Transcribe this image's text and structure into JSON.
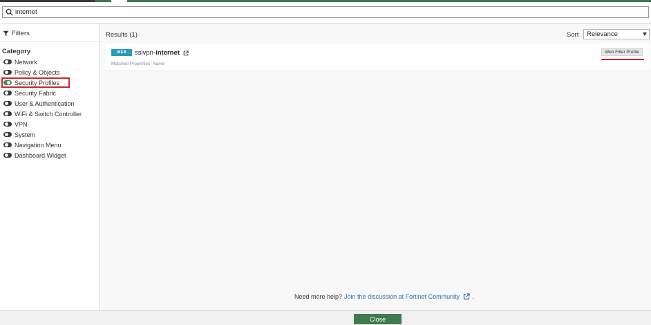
{
  "search": {
    "value": "internet"
  },
  "sidebar": {
    "filters_label": "Filters",
    "category_label": "Category",
    "items": [
      {
        "label": "Network",
        "enabled": false
      },
      {
        "label": "Policy & Objects",
        "enabled": false
      },
      {
        "label": "Security Profiles",
        "enabled": true
      },
      {
        "label": "Security Fabric",
        "enabled": false
      },
      {
        "label": "User & Authentication",
        "enabled": false
      },
      {
        "label": "WiFi & Switch Controller",
        "enabled": false
      },
      {
        "label": "VPN",
        "enabled": false
      },
      {
        "label": "System",
        "enabled": false
      },
      {
        "label": "Navigation Menu",
        "enabled": false
      },
      {
        "label": "Dashboard Widget",
        "enabled": false
      }
    ]
  },
  "main": {
    "results_label": "Results (1)",
    "sort_label": "Sort",
    "sort_value": "Relevance",
    "result": {
      "badge": "WEB",
      "name_prefix": "sslvpn-",
      "name_match": "internet",
      "matched_label": "Matched Properties:",
      "matched_value": "Name",
      "type_tag": "Web Filter Profile"
    },
    "help_text": "Need more help?",
    "help_link": "Join the discussion at Fortinet Community",
    "help_suffix": "."
  },
  "footer": {
    "close_label": "Close"
  },
  "colors": {
    "accent": "#3f7a4d",
    "badge": "#2b9bbd",
    "highlight": "#d2222a",
    "link": "#2d6a9f"
  }
}
